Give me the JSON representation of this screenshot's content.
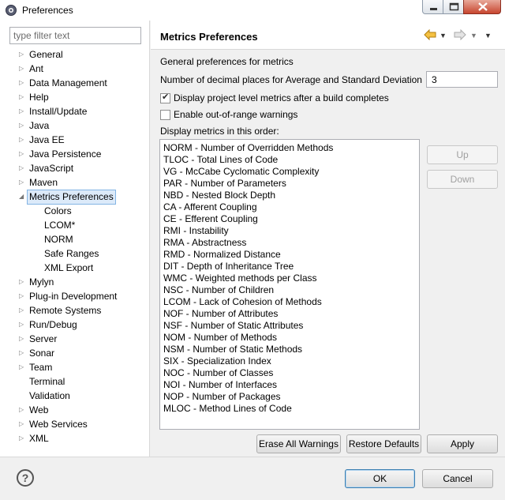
{
  "window": {
    "title": "Preferences"
  },
  "filter": {
    "placeholder": "type filter text"
  },
  "tree": [
    {
      "label": "General",
      "expandable": true
    },
    {
      "label": "Ant",
      "expandable": true
    },
    {
      "label": "Data Management",
      "expandable": true
    },
    {
      "label": "Help",
      "expandable": true
    },
    {
      "label": "Install/Update",
      "expandable": true
    },
    {
      "label": "Java",
      "expandable": true
    },
    {
      "label": "Java EE",
      "expandable": true
    },
    {
      "label": "Java Persistence",
      "expandable": true
    },
    {
      "label": "JavaScript",
      "expandable": true
    },
    {
      "label": "Maven",
      "expandable": true
    },
    {
      "label": "Metrics Preferences",
      "expandable": true,
      "expanded": true,
      "selected": true
    },
    {
      "label": "Colors",
      "child": true
    },
    {
      "label": "LCOM*",
      "child": true
    },
    {
      "label": "NORM",
      "child": true
    },
    {
      "label": "Safe Ranges",
      "child": true
    },
    {
      "label": "XML Export",
      "child": true
    },
    {
      "label": "Mylyn",
      "expandable": true
    },
    {
      "label": "Plug-in Development",
      "expandable": true
    },
    {
      "label": "Remote Systems",
      "expandable": true
    },
    {
      "label": "Run/Debug",
      "expandable": true
    },
    {
      "label": "Server",
      "expandable": true
    },
    {
      "label": "Sonar",
      "expandable": true
    },
    {
      "label": "Team",
      "expandable": true
    },
    {
      "label": "Terminal",
      "expandable": false
    },
    {
      "label": "Validation",
      "expandable": false
    },
    {
      "label": "Web",
      "expandable": true
    },
    {
      "label": "Web Services",
      "expandable": true
    },
    {
      "label": "XML",
      "expandable": true
    }
  ],
  "page": {
    "title": "Metrics Preferences",
    "section_label": "General preferences for metrics",
    "decimal_label": "Number of decimal places for Average and Standard Deviation",
    "decimal_value": "3",
    "checkbox_project_level": {
      "label": "Display project level metrics after a build completes",
      "checked": true
    },
    "checkbox_out_of_range": {
      "label": "Enable out-of-range warnings",
      "checked": false
    },
    "order_label": "Display metrics in this order:",
    "metrics": [
      "NORM - Number of Overridden Methods",
      "TLOC - Total Lines of Code",
      "VG - McCabe Cyclomatic Complexity",
      "PAR - Number of Parameters",
      "NBD - Nested Block Depth",
      "CA - Afferent Coupling",
      "CE - Efferent Coupling",
      "RMI - Instability",
      "RMA - Abstractness",
      "RMD - Normalized Distance",
      "DIT - Depth of Inheritance Tree",
      "WMC - Weighted methods per Class",
      "NSC - Number of Children",
      "LCOM - Lack of Cohesion of Methods",
      "NOF - Number of Attributes",
      "NSF - Number of Static Attributes",
      "NOM - Number of Methods",
      "NSM - Number of Static Methods",
      "SIX - Specialization Index",
      "NOC - Number of Classes",
      "NOI - Number of Interfaces",
      "NOP - Number of Packages",
      "MLOC - Method Lines of Code"
    ],
    "up_label": "Up",
    "down_label": "Down",
    "erase_label": "Erase All Warnings",
    "restore_label": "Restore Defaults",
    "apply_label": "Apply"
  },
  "footer": {
    "ok_label": "OK",
    "cancel_label": "Cancel",
    "help_glyph": "?"
  },
  "icons": {
    "app": "preferences-app-icon",
    "back": "back-arrow-icon",
    "forward": "forward-arrow-icon",
    "help": "help-icon"
  }
}
